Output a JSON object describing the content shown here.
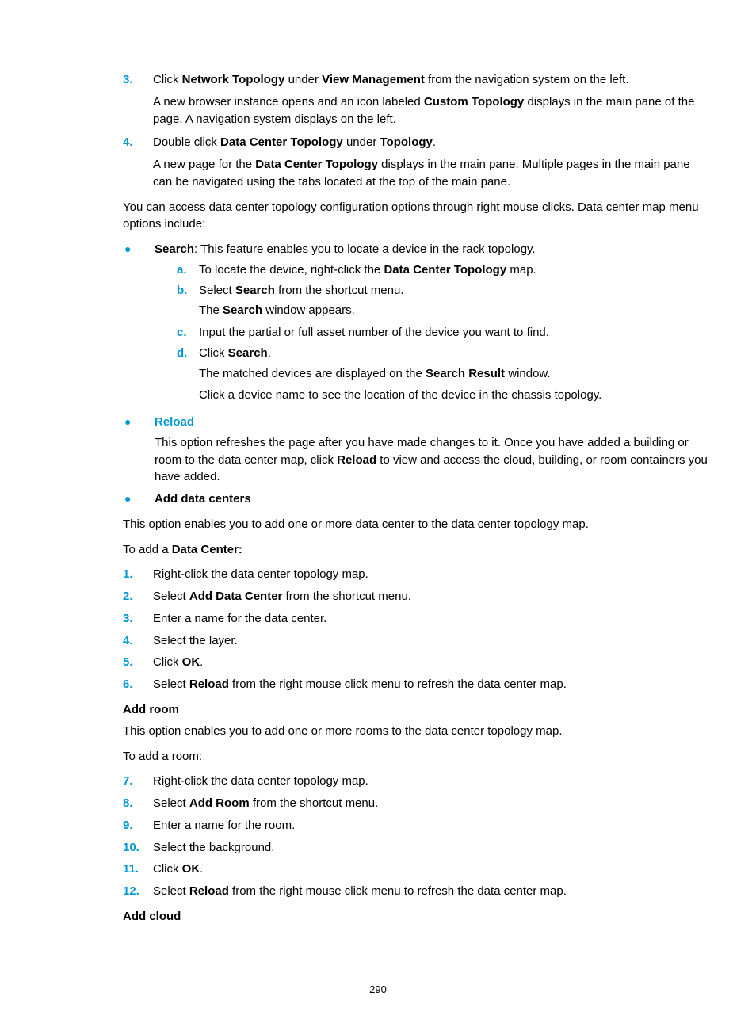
{
  "step3_num": "3.",
  "step3_pre": "Click ",
  "step3_b1": "Network Topology",
  "step3_mid": " under ",
  "step3_b2": "View Management",
  "step3_post": " from the navigation system on the left.",
  "step3_p_pre": "A new browser instance opens and an icon labeled ",
  "step3_p_b": "Custom Topology",
  "step3_p_post": " displays in the main pane of the page. A navigation system displays on the left.",
  "step4_num": "4.",
  "step4_pre": "Double click ",
  "step4_b1": "Data Center Topology",
  "step4_mid": " under ",
  "step4_b2": "Topology",
  "step4_post": ".",
  "step4_p_pre": "A new page for the ",
  "step4_p_b": "Data Center Topology",
  "step4_p_post": " displays in the main pane. Multiple pages in the main pane can be navigated using the tabs located at the top of the main pane.",
  "intro": "You can access data center topology configuration options through right mouse clicks. Data center map menu options include:",
  "search_b": "Search",
  "search_desc": ": This feature enables you to locate a device in the rack topology.",
  "sa_num": "a.",
  "sa_pre": "To locate the device, right-click the ",
  "sa_b": "Data Center Topology",
  "sa_post": " map.",
  "sb_num": "b.",
  "sb_pre": "Select ",
  "sb_b": "Search",
  "sb_post": " from the shortcut menu.",
  "sb_p_pre": "The ",
  "sb_p_b": "Search",
  "sb_p_post": " window appears.",
  "sc_num": "c.",
  "sc_text": "Input the partial or full asset number of the device you want to find.",
  "sd_num": "d.",
  "sd_pre": "Click ",
  "sd_b": "Search",
  "sd_post": ".",
  "sd_p1_pre": "The matched devices are displayed on the ",
  "sd_p1_b": "Search Result",
  "sd_p1_post": " window.",
  "sd_p2": "Click a device name to see the location of the device in the chassis topology.",
  "reload_title": "Reload",
  "reload_p_pre": "This option refreshes the page after you have made changes to it. Once you have added a building or room to the data center map, click ",
  "reload_p_b": "Reload",
  "reload_p_post": " to view and access the cloud, building, or room containers you have added.",
  "adc_title": "Add data centers",
  "adc_desc": "This option enables you to add one or more data center to the data center topology map.",
  "adc_toadd_pre": "To add a ",
  "adc_toadd_b": "Data Center:",
  "d1_num": "1.",
  "d1_text": "Right-click the data center topology map.",
  "d2_num": "2.",
  "d2_pre": "Select ",
  "d2_b": "Add Data Center",
  "d2_post": " from the shortcut menu.",
  "d3_num": "3.",
  "d3_text": "Enter a name for the data center.",
  "d4_num": "4.",
  "d4_text": "Select the layer.",
  "d5_num": "5.",
  "d5_pre": "Click ",
  "d5_b": "OK",
  "d5_post": ".",
  "d6_num": "6.",
  "d6_pre": "Select ",
  "d6_b": "Reload",
  "d6_post": " from the right mouse click menu to refresh the data center map.",
  "ar_title": "Add room",
  "ar_desc": "This option enables you to add one or more rooms to the data center topology map.",
  "ar_toadd": "To add a room:",
  "r7_num": "7.",
  "r7_text": "Right-click the data center topology map.",
  "r8_num": "8.",
  "r8_pre": "Select ",
  "r8_b": "Add Room",
  "r8_post": " from the shortcut menu.",
  "r9_num": "9.",
  "r9_text": "Enter a name for the room.",
  "r10_num": "10.",
  "r10_text": "Select the background.",
  "r11_num": "11.",
  "r11_pre": "Click ",
  "r11_b": "OK",
  "r11_post": ".",
  "r12_num": "12.",
  "r12_pre": "Select ",
  "r12_b": "Reload",
  "r12_post": " from the right mouse click menu to refresh the data center map.",
  "ac_title": "Add cloud",
  "page_number": "290"
}
